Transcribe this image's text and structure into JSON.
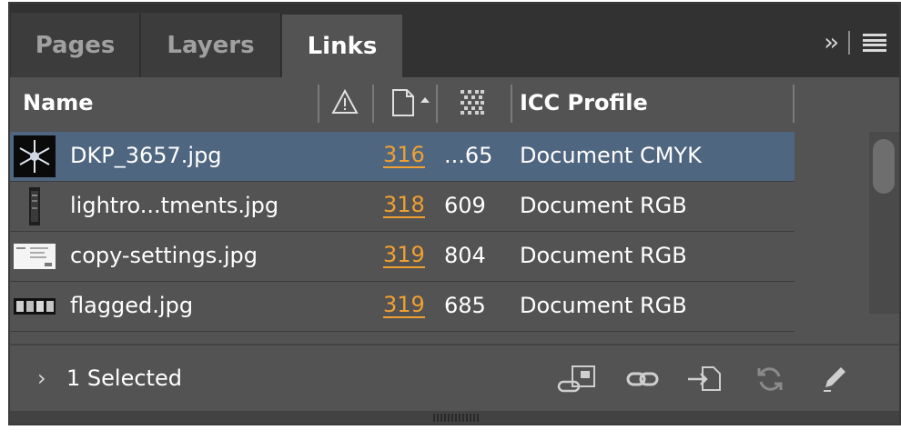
{
  "tabs": [
    {
      "label": "Pages",
      "active": false
    },
    {
      "label": "Layers",
      "active": false
    },
    {
      "label": "Links",
      "active": true
    }
  ],
  "tab_controls": {
    "collapse": "collapse-panel-icon",
    "menu": "panel-menu-icon"
  },
  "columns": {
    "name": "Name",
    "status_icon": "warning-icon",
    "page_icon": "page-sort-icon",
    "size_icon": "pixel-grid-icon",
    "icc": "ICC Profile"
  },
  "links": [
    {
      "name": "DKP_3657.jpg",
      "page": "316",
      "size": "...65",
      "icc": "Document CMYK",
      "selected": true
    },
    {
      "name": "lightro...tments.jpg",
      "page": "318",
      "size": "609",
      "icc": "Document RGB",
      "selected": false
    },
    {
      "name": "copy-settings.jpg",
      "page": "319",
      "size": "804",
      "icc": "Document RGB",
      "selected": false
    },
    {
      "name": "flagged.jpg",
      "page": "319",
      "size": "685",
      "icc": "Document RGB",
      "selected": false
    }
  ],
  "footer": {
    "selected_label": "1 Selected",
    "icons": [
      "relink-cc-icon",
      "link-icon",
      "go-to-link-icon",
      "update-link-icon",
      "edit-original-icon"
    ]
  },
  "colors": {
    "panel_bg": "#535353",
    "selection": "#4f6680",
    "page_link": "#f0a030"
  }
}
